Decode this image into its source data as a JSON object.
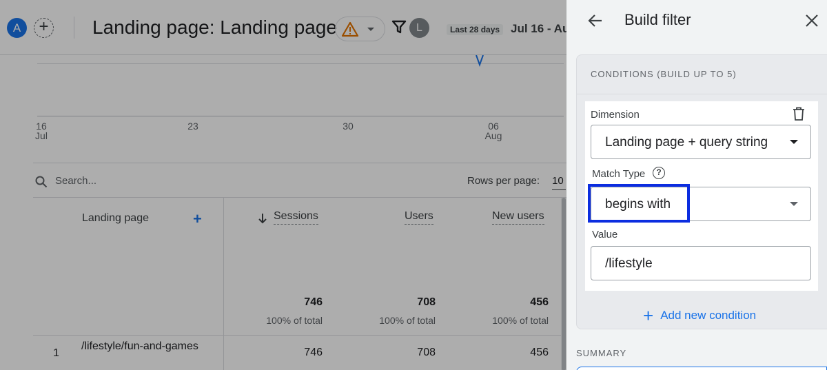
{
  "header": {
    "account_initial": "A",
    "page_title": "Landing page: Landing page",
    "user_initial": "L",
    "date_chip": "Last 28 days",
    "date_range": "Jul 16 - Au"
  },
  "chart": {
    "x_ticks": [
      {
        "day": "16",
        "month": "Jul"
      },
      {
        "day": "23",
        "month": ""
      },
      {
        "day": "30",
        "month": ""
      },
      {
        "day": "06",
        "month": "Aug"
      }
    ]
  },
  "table": {
    "search_placeholder": "Search...",
    "rows_per_page_label": "Rows per page:",
    "rows_per_page_value": "10",
    "columns": {
      "dimension": "Landing page",
      "sessions": "Sessions",
      "users": "Users",
      "new_users": "New users"
    },
    "totals": {
      "sessions": "746",
      "sessions_pct": "100% of total",
      "users": "708",
      "users_pct": "100% of total",
      "new_users": "456",
      "new_users_pct": "100% of total"
    },
    "rows": [
      {
        "num": "1",
        "page": "/lifestyle/fun-and-games",
        "sessions": "746",
        "users": "708",
        "new_users": "456"
      }
    ]
  },
  "panel": {
    "title": "Build filter",
    "conditions_title": "CONDITIONS (BUILD UP TO 5)",
    "dimension_label": "Dimension",
    "dimension_value": "Landing page + query string",
    "match_type_label": "Match Type",
    "match_type_value": "begins with",
    "value_label": "Value",
    "value_text": "/lifestyle",
    "add_condition": "Add new condition",
    "summary_title": "SUMMARY"
  },
  "colors": {
    "accent": "#1a73e8",
    "highlight": "#0b2de0",
    "warning": "#e37400"
  }
}
